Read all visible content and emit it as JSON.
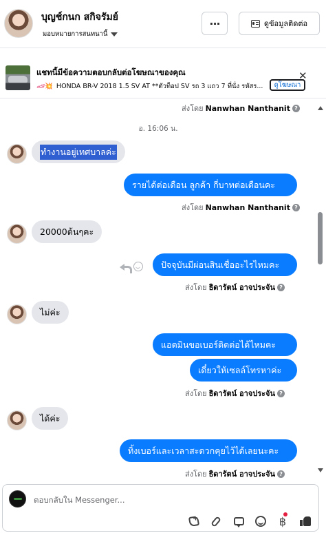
{
  "header": {
    "contact_name": "บุญช์กนก สกิจรัมย์",
    "assign_label": "มอบหมายการสนทนานี้",
    "more_label": "···",
    "contact_info_label": "ดูข้อมูลติดต่อ"
  },
  "ad": {
    "title": "แชทนี้มีข้อความตอบกลับต่อโฆษณาของคุณ",
    "subtitle_emoji": "🏎💥",
    "subtitle": "HONDA BR-V 2018 1.5 SV AT **ตัวท็อป SV รถ 3 แถว 7 ที่นั่ง รหัสร...",
    "link_label": "ดูโฆษณา",
    "close_label": "✕"
  },
  "messages": {
    "sent_by_prefix": "ส่งโดย",
    "sender_1": "Nanwhan Nanthanit",
    "sender_2": "ธิดารัตน์ อาจประจัน",
    "help_icon": "?",
    "timestamp": "อ. 16:06 น.",
    "in_1": "ทำงานอยู่เทศบาลค่ะ",
    "out_1": "รายได้ต่อเดือน ลูกค้า กี่บาทต่อเดือนคะ",
    "in_2": "20000ต้นๆคะ",
    "out_2": "ปัจจุบันมีผ่อนสินเชื่ออะไรไหมคะ",
    "in_3": "ไม่ค่ะ",
    "out_3": "แอดมินขอเบอร์ติดต่อได้ไหมคะ",
    "out_4": "เดี๋ยวให้เซลล์โทรหาค่ะ",
    "in_4": "ได้ค่ะ",
    "out_5": "ทิ้งเบอร์และเวลาสะดวกคุยไว้ได้เลยนะคะ"
  },
  "composer": {
    "placeholder": "ตอบกลับใน Messenger...",
    "baht_symbol": "฿"
  },
  "colors": {
    "outgoing_bubble": "#0a7cff",
    "incoming_bubble": "#e4e6eb",
    "highlight": "#2f5fd0",
    "notification_dot": "#e41e3f"
  }
}
